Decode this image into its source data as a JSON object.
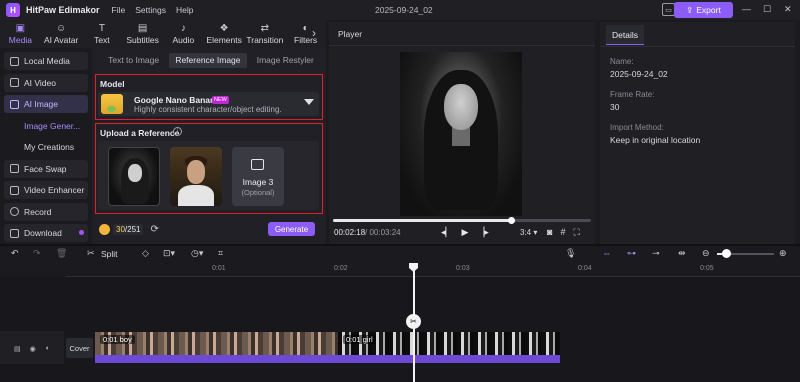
{
  "app": {
    "logo_text": "H",
    "name": "HitPaw Edimakor",
    "menu": [
      "File",
      "Settings",
      "Help"
    ],
    "document_title": "2025-09-24_02",
    "export_label": "Export",
    "accent_color": "#8b5cf6"
  },
  "toolbar": {
    "tools": [
      {
        "label": "Media",
        "icon": "media-icon"
      },
      {
        "label": "AI Avatar",
        "icon": "ai-avatar-icon"
      },
      {
        "label": "Text",
        "icon": "text-icon"
      },
      {
        "label": "Subtitles",
        "icon": "subtitles-icon"
      },
      {
        "label": "Audio",
        "icon": "audio-icon"
      },
      {
        "label": "Elements",
        "icon": "elements-icon"
      },
      {
        "label": "Transition",
        "icon": "transition-icon"
      },
      {
        "label": "Filters",
        "icon": "filters-icon"
      }
    ],
    "active": "Media"
  },
  "leftnav": {
    "items": [
      {
        "label": "Local Media"
      },
      {
        "label": "AI Video"
      },
      {
        "label": "AI Image"
      },
      {
        "label": "Image Gener..."
      },
      {
        "label": "My Creations"
      },
      {
        "label": "Face Swap"
      },
      {
        "label": "Video Enhancer"
      },
      {
        "label": "Record"
      },
      {
        "label": "Download"
      }
    ]
  },
  "ai_image": {
    "tabs": [
      "Text to Image",
      "Reference Image",
      "Image Restyler"
    ],
    "active_tab": "Reference Image",
    "model_title": "Model",
    "model_name": "Google Nano Banana",
    "model_badge": "NEW",
    "model_desc": "Highly consistent character/object editing.",
    "upload_title": "Upload a Reference",
    "upload_slot_label": "Image 3",
    "upload_slot_optional": "(Optional)",
    "credits_used": "30",
    "credits_total": "/251",
    "generate_label": "Generate"
  },
  "player": {
    "title": "Player",
    "current_time": "00:02:18",
    "total_time": "/ 00:03:24",
    "aspect_ratio": "3:4",
    "progress": 0.69
  },
  "details": {
    "tab": "Details",
    "name_key": "Name:",
    "name_value": "2025-09-24_02",
    "framerate_key": "Frame Rate:",
    "framerate_value": "30",
    "import_key": "Import Method:",
    "import_value": "Keep in original location"
  },
  "timeline": {
    "split_label": "Split",
    "ticks": [
      "0:01",
      "0:02",
      "0:03",
      "0:04",
      "0:05"
    ],
    "cover_label": "Cover",
    "clips": [
      {
        "label": "0:01 boy"
      },
      {
        "label": "0:01 girl"
      }
    ],
    "zoom_level": 0.17
  }
}
